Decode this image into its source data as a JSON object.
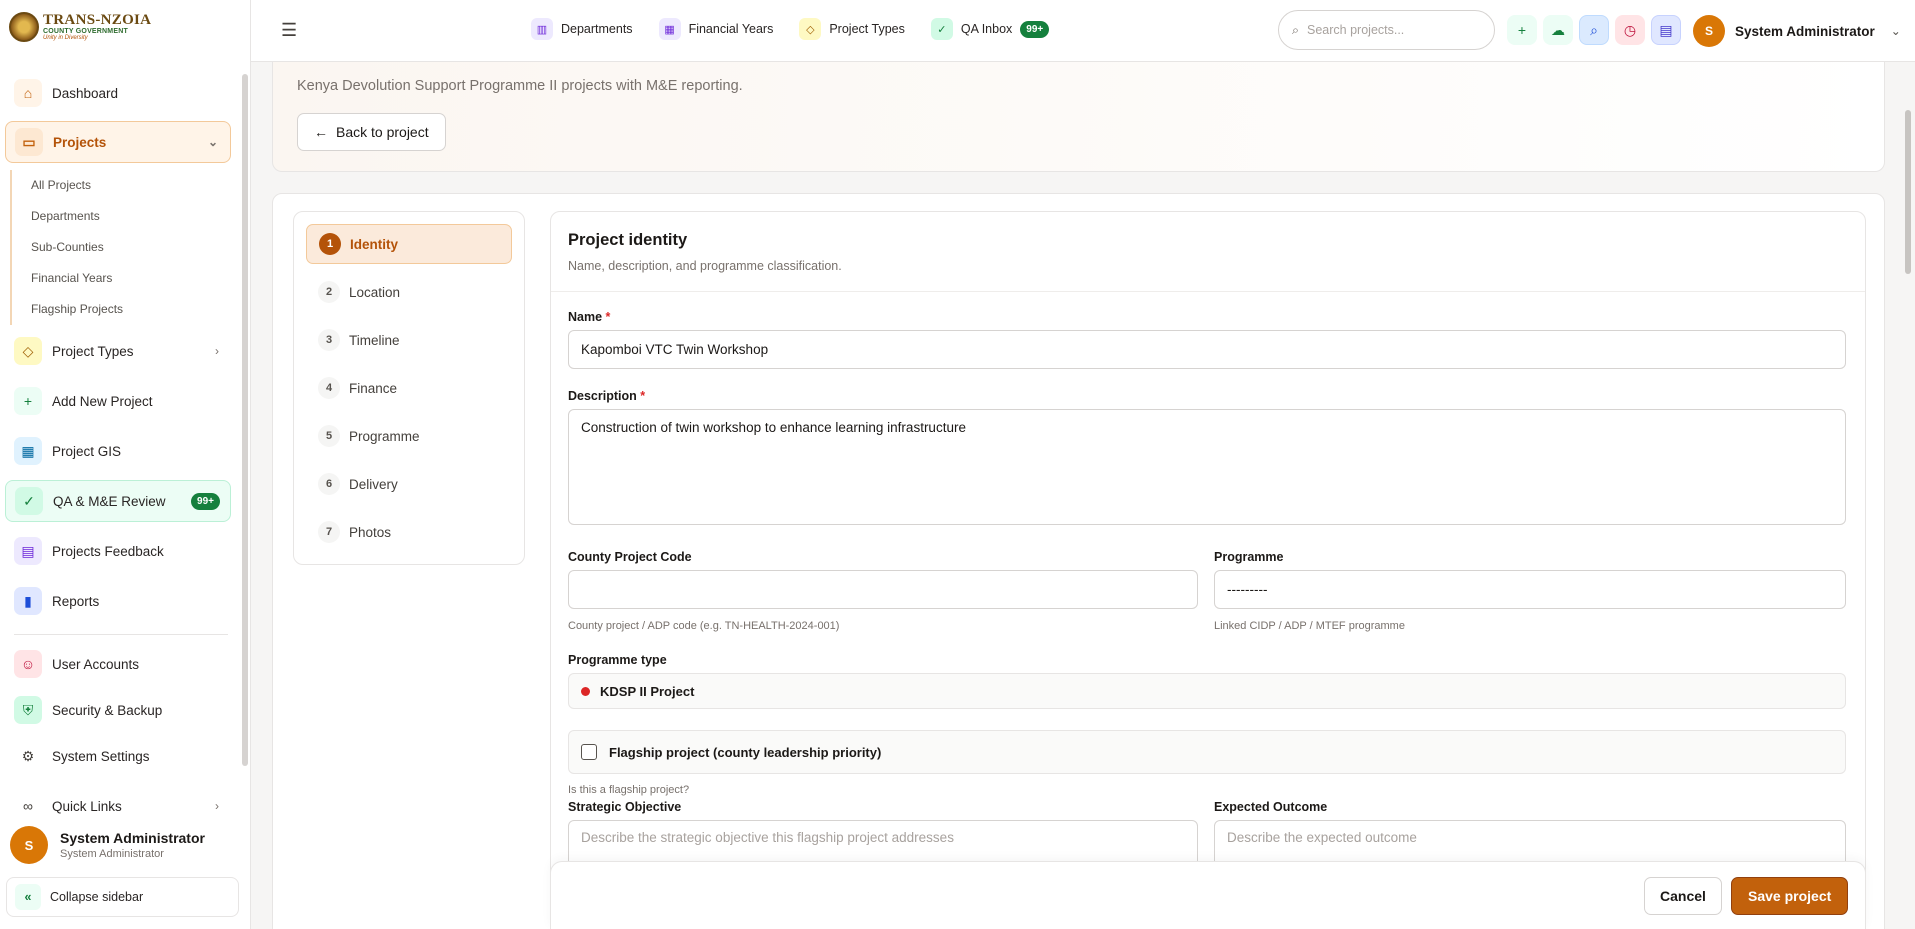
{
  "logo": {
    "line1": "TRANS-NZOIA",
    "line2": "COUNTY GOVERNMENT",
    "line3": "Unity in Diversity"
  },
  "sidebar": {
    "items": [
      {
        "label": "Dashboard"
      },
      {
        "label": "Projects"
      },
      {
        "label": "Project Types"
      },
      {
        "label": "Add New Project"
      },
      {
        "label": "Project GIS"
      },
      {
        "label": "QA & M&E Review",
        "badge": "99+"
      },
      {
        "label": "Projects Feedback"
      },
      {
        "label": "Reports"
      },
      {
        "label": "User Accounts"
      },
      {
        "label": "Security & Backup"
      },
      {
        "label": "System Settings"
      },
      {
        "label": "Quick Links"
      }
    ],
    "submenu": [
      "All Projects",
      "Departments",
      "Sub-Counties",
      "Financial Years",
      "Flagship Projects"
    ],
    "user": {
      "initial": "S",
      "name": "System Administrator",
      "role": "System Administrator"
    },
    "collapse_label": "Collapse sidebar"
  },
  "header": {
    "links": [
      {
        "label": "Departments"
      },
      {
        "label": "Financial Years"
      },
      {
        "label": "Project Types"
      },
      {
        "label": "QA Inbox",
        "badge": "99+"
      }
    ],
    "search_placeholder": "Search projects...",
    "user": {
      "initial": "S",
      "name": "System Administrator"
    }
  },
  "hero": {
    "subtitle": "Kenya Devolution Support Programme II projects with M&E reporting.",
    "back_label": "Back to project"
  },
  "steps": [
    {
      "num": "1",
      "label": "Identity"
    },
    {
      "num": "2",
      "label": "Location"
    },
    {
      "num": "3",
      "label": "Timeline"
    },
    {
      "num": "4",
      "label": "Finance"
    },
    {
      "num": "5",
      "label": "Programme"
    },
    {
      "num": "6",
      "label": "Delivery"
    },
    {
      "num": "7",
      "label": "Photos"
    }
  ],
  "form": {
    "title": "Project identity",
    "subtitle": "Name, description, and programme classification.",
    "name_label": "Name",
    "name_value": "Kapomboi VTC Twin Workshop",
    "description_label": "Description",
    "description_value": "Construction of twin workshop to enhance learning infrastructure",
    "code_label": "County Project Code",
    "code_value": "",
    "code_hint": "County project / ADP code (e.g. TN-HEALTH-2024-001)",
    "programme_label": "Programme",
    "programme_value": "---------",
    "programme_hint": "Linked CIDP / ADP / MTEF programme",
    "programme_type_label": "Programme type",
    "programme_type_value": "KDSP II Project",
    "flagship_label": "Flagship project (county leadership priority)",
    "flagship_hint": "Is this a flagship project?",
    "strategic_label": "Strategic Objective",
    "strategic_placeholder": "Describe the strategic objective this flagship project addresses",
    "outcome_label": "Expected Outcome",
    "outcome_placeholder": "Describe the expected outcome",
    "required_mark": "*"
  },
  "footer": {
    "cancel_label": "Cancel",
    "save_label": "Save project"
  },
  "colors": {
    "accent": "#c2610c",
    "success": "#15803d",
    "danger": "#dc2626"
  }
}
